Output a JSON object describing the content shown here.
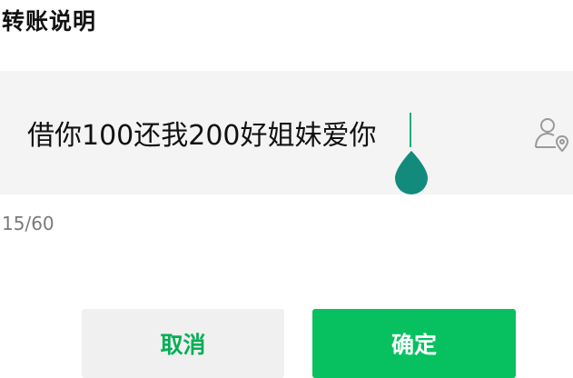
{
  "title": "转账说明",
  "input": {
    "value": "借你100还我200好姐妹爱你",
    "counter": "15/60"
  },
  "icons": {
    "contact": "contact-location-icon",
    "handle": "cursor-drop-handle-icon"
  },
  "buttons": {
    "cancel_label": "取消",
    "confirm_label": "确定"
  },
  "colors": {
    "accent": "#07c160",
    "accent_text": "#06ae56",
    "handle": "#138b7c",
    "input_bg": "#f4f4f4",
    "cancel_bg": "#f0f0f0"
  }
}
